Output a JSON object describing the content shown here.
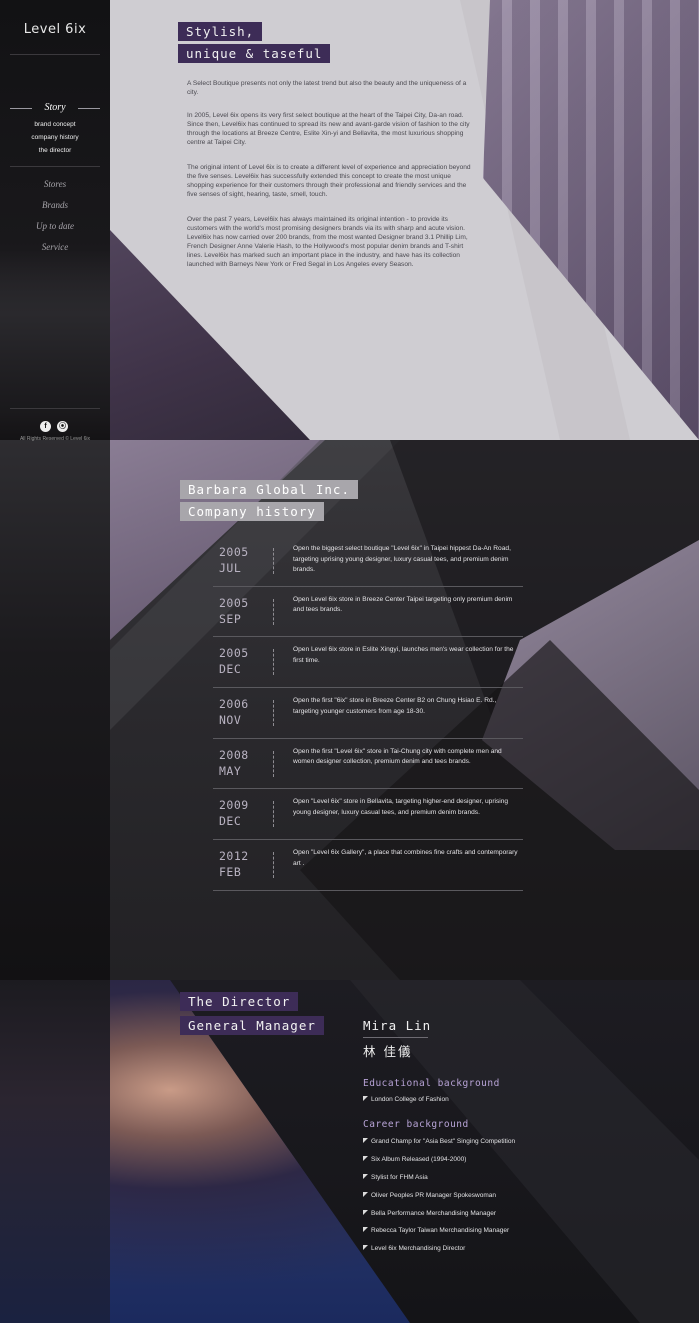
{
  "sidebar": {
    "logo": "Level 6ix",
    "story_label": "Story",
    "sub_items": [
      "brand concept",
      "company history",
      "the director"
    ],
    "nav_items": [
      "Stores",
      "Brands",
      "Up to date",
      "Service"
    ],
    "social": [
      "facebook-icon",
      "rss-icon"
    ],
    "copyright": "All Rights Reserved © Level 6ix"
  },
  "story": {
    "tag_line1": "Stylish,",
    "tag_line2": "unique & taseful",
    "paragraphs": [
      "A Select Boutique presents not only the latest trend but also the beauty and the uniqueness of a city.",
      "In 2005, Level 6ix opens its very first select boutique at the heart of the Taipei City, Da-an road. Since then, Level6ix has continued to spread its new and avant-garde vision of fashion to the city through the locations at Breeze Centre, Eslite Xin-yi and Bellavita, the most luxurious shopping centre at Taipei City.",
      "The original intent of Level 6ix is to create a different level of experience and appreciation beyond the five senses. Level6ix has successfully extended this concept to create the most unique shopping experience for their customers through their professional and friendly services and the five senses of sight, hearing, taste, smell, touch.",
      "Over the past 7 years, Level6ix has always maintained its original intention - to provide its customers with the world's most promising designers brands via its with sharp and acute vision. Level6ix has now carried over 200 brands, from the most wanted Designer brand 3.1 Phillip Lim, French Designer Anne Valerie Hash, to the Hollywood's most popular denim brands and T-shirt lines. Level6ix has marked such an important place in the industry, and have has its collection launched with Barneys New York or Fred Segal in Los Angeles every Season."
    ]
  },
  "history": {
    "tag_line1": "Barbara Global Inc.",
    "tag_line2": "Company history",
    "entries": [
      {
        "year": "2005",
        "month": "JUL",
        "text": "Open the biggest select boutique \"Level 6ix\" in Taipei hippest Da-An Road, targeting uprising young designer, luxury casual tees, and premium denim brands."
      },
      {
        "year": "2005",
        "month": "SEP",
        "text": "Open Level 6ix store in Breeze Center Taipei targeting only premium denim and tees brands."
      },
      {
        "year": "2005",
        "month": "DEC",
        "text": "Open Level 6ix store in Eslite Xingyi, launches men's wear collection for the first time."
      },
      {
        "year": "2006",
        "month": "NOV",
        "text": "Open the first \"6ix\" store in Breeze Center B2 on Chung Hsiao E. Rd., targeting younger customers from age 18-30."
      },
      {
        "year": "2008",
        "month": "MAY",
        "text": "Open the first \"Level 6ix\" store in Tai-Chung city with complete men and women designer collection, premium denim and tees brands."
      },
      {
        "year": "2009",
        "month": "DEC",
        "text": "Open \"Level 6ix\" store in Bellavita, targeting higher-end designer, uprising young designer, luxury casual tees, and premium denim brands."
      },
      {
        "year": "2012",
        "month": "FEB",
        "text": "Open \"Level 6ix Gallery\", a place that combines fine crafts and contemporary art ."
      }
    ]
  },
  "director": {
    "tag_line1": "The Director",
    "tag_line2": "General Manager",
    "name": "Mira Lin",
    "name_zh": "林 佳儀",
    "edu_heading": "Educational background",
    "edu_items": [
      "London College of Fashion"
    ],
    "career_heading": "Career background",
    "career_items": [
      "Grand Champ for \"Asia Best\" Singing Competition",
      "Six Album Released (1994-2000)",
      "Stylist for FHM Asia",
      "Oliver Peoples PR Manager Spokeswoman",
      "Bella Performance Merchandising Manager",
      "Rebecca Taylor Taiwan Merchandising Manager",
      "Level 6ix Merchandising Director"
    ]
  },
  "colors": {
    "accent_purple": "#3d2c57",
    "heading_lilac": "#b7a3d6",
    "tag_grey": "#a8a6ab"
  }
}
